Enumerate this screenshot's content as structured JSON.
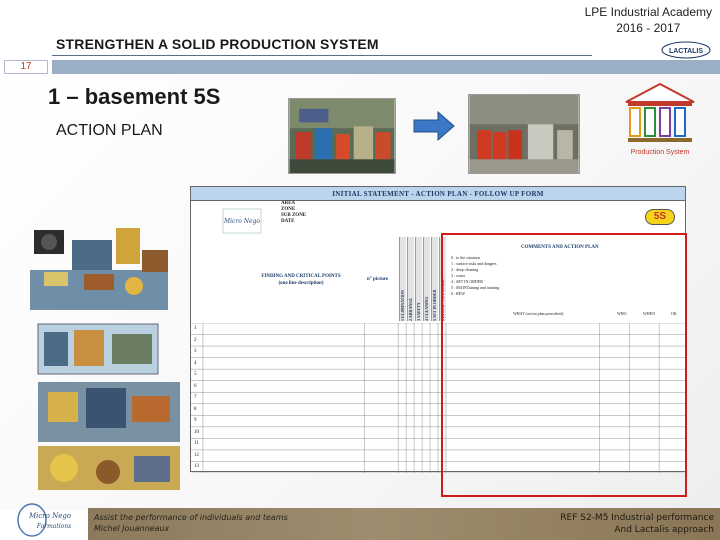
{
  "header": {
    "title": "STRENGTHEN A SOLID PRODUCTION SYSTEM",
    "academy_line1": "LPE Industrial Academy",
    "academy_line2": "2016 - 2017",
    "logo_text": "LACTALIS"
  },
  "slide": {
    "number": "17",
    "section_title": "1 – basement 5S",
    "subtitle": "ACTION PLAN"
  },
  "production_system": {
    "caption": "Production System"
  },
  "form": {
    "heading": "INITIAL STATEMENT - ACTION PLAN - FOLLOW UP FORM",
    "logo_text": "Micro Nego",
    "meta_fields": [
      "AREA",
      "ZONE",
      "SUB ZONE",
      "DATE"
    ],
    "badge": "5S",
    "finding_header": "FINDING AND CRITICAL POINTS",
    "finding_subheader": "(one line description)",
    "picture_header": "n° picture",
    "vertical_headers": [
      "1 ELIMINATION",
      "2 ARRANGE",
      "3 SAFETY",
      "4 CLEANING",
      "5 SET IN ORDER",
      "6 RIGOR / STANDARD"
    ],
    "comments_header": "COMMENTS AND ACTION PLAN",
    "criteria": [
      "0 : to the situation",
      "1 : surface risks and dangers",
      "2 : deep cleaning",
      "3 : waste",
      "4 : SET IN ORDER",
      "5 : MAINTaining and training",
      "6 : REW"
    ],
    "what_label": "WHAT (action plan prescribed)",
    "who_label": "WHO",
    "when_label": "WHEN",
    "ok_label": "OK",
    "rows": [
      "1",
      "2",
      "3",
      "4",
      "5",
      "6",
      "7",
      "8",
      "9",
      "10",
      "11",
      "12",
      "13"
    ]
  },
  "footer": {
    "left_line1": "Assist the performance of individuals and teams",
    "left_line2": "Michel Jouanneaux",
    "right_line1": "REF S2-M5 Industrial performance",
    "right_line2": "And Lactalis approach",
    "logo_line1": "Micro Nego",
    "logo_line2": "Formations"
  },
  "colors": {
    "slide_bar": "#9aaec6",
    "form_header": "#bcd5ec",
    "highlight_frame": "#d21a1a",
    "badge_fill": "#f6d31a",
    "footer_band": "#8b7a5c"
  },
  "icons": [
    "arrow-right-icon",
    "production-system-house-icon",
    "lactalis-logo-icon",
    "micro-nego-logo-icon",
    "five-s-badge-icon"
  ]
}
